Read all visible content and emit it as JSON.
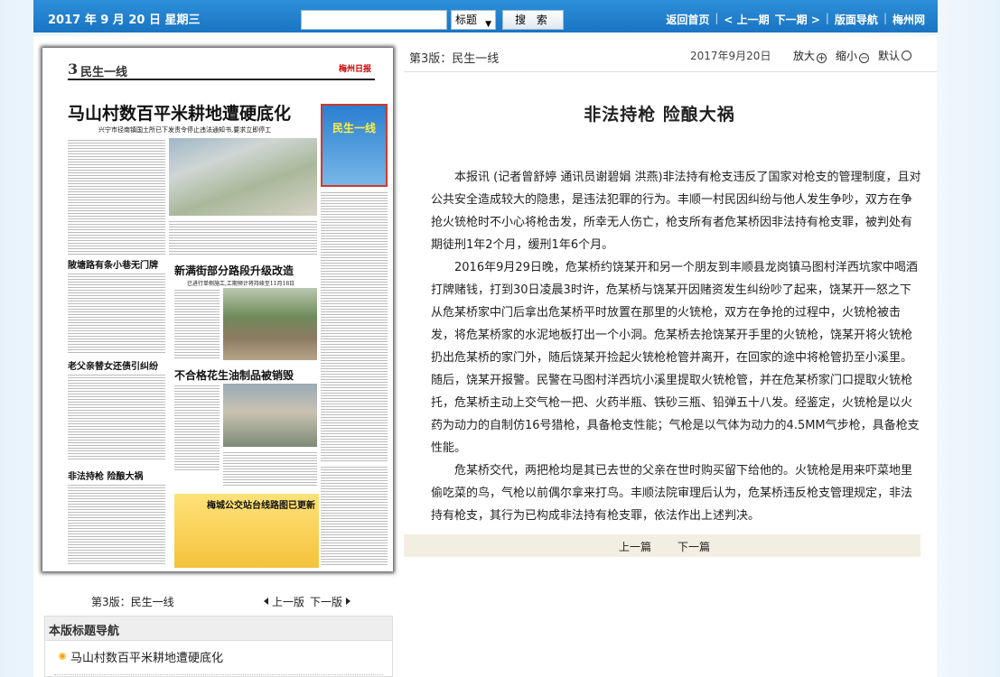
{
  "topbar": {
    "date": "2017 年 9 月 20 日   星期三",
    "search_placeholder": "",
    "select_value": "标题",
    "search_button": "搜 索",
    "nav": [
      "返回首页",
      "< 上一期",
      "下一期 >",
      "版面导航",
      "梅州网"
    ],
    "nav_seps": [
      "|",
      "|",
      "|",
      "|"
    ]
  },
  "paper": {
    "page_num": "3",
    "section": "民生一线",
    "brand": "梅州日报",
    "headlines": {
      "main": "马山村数百平米耕地遭硬底化",
      "main_sub": "兴宁市径南镇国土所已下发责令停止违法通知书,要求立即停工",
      "h2": "陂塘路有条小巷无门牌",
      "h3": "新满街部分路段升级改造",
      "h3_sub": "已进行单侧施工,工期预计将持续至11月18日",
      "h4": "老父亲替女还债引纠纷",
      "h5": "不合格花生油制品被销毁",
      "h6": "非法持枪  险酿大祸",
      "h7": "梅城公交站台线路图已更新",
      "badge": "民生一线"
    }
  },
  "left_pager": {
    "page_label": "第3版：民生一线",
    "prev": "上一版",
    "next": "下一版"
  },
  "nav_box": {
    "header": "本版标题导航",
    "items": [
      "马山村数百平米耕地遭硬底化"
    ]
  },
  "article": {
    "section": "第3版：民生一线",
    "date": "2017年9月20日",
    "zoom_in": "放大",
    "zoom_out": "缩小",
    "zoom_default": "默认",
    "zoom_in_glyph": "+",
    "zoom_out_glyph": "−",
    "title": "非法持枪  险酿大祸",
    "paragraphs": [
      "本报讯 (记者曾舒婷 通讯员谢碧娟 洪燕)非法持有枪支违反了国家对枪支的管理制度，且对公共安全造成较大的隐患，是违法犯罪的行为。丰顺一村民因纠纷与他人发生争吵，双方在争抢火铳枪时不小心将枪击发，所幸无人伤亡，枪支所有者危某桥因非法持有枪支罪，被判处有期徒刑1年2个月，缓刑1年6个月。",
      "2016年9月29日晚，危某桥约饶某开和另一个朋友到丰顺县龙岗镇马图村洋西坑家中喝酒打牌赌钱，打到30日凌晨3时许，危某桥与饶某开因赌资发生纠纷吵了起来，饶某开一怒之下从危某桥家中门后拿出危某桥平时放置在那里的火铳枪，双方在争抢的过程中，火铳枪被击发，将危某桥家的水泥地板打出一个小洞。危某桥去抢饶某开手里的火铳枪，饶某开将火铳枪扔出危某桥的家门外，随后饶某开捡起火铳枪枪管并离开，在回家的途中将枪管扔至小溪里。随后，饶某开报警。民警在马图村洋西坑小溪里提取火铳枪管，并在危某桥家门口提取火铳枪托，危某桥主动上交气枪一把、火药半瓶、铁砂三瓶、铅弹五十八发。经鉴定，火铳枪是以火药为动力的自制仿16号猎枪，具备枪支性能；气枪是以气体为动力的4.5MM气步枪，具备枪支性能。",
      "危某桥交代，两把枪均是其已去世的父亲在世时购买留下给他的。火铳枪是用来吓菜地里偷吃菜的鸟，气枪以前偶尔拿来打鸟。丰顺法院审理后认为，危某桥违反枪支管理规定，非法持有枪支，其行为已构成非法持有枪支罪，依法作出上述判决。"
    ],
    "prev_article": "上一篇",
    "next_article": "下一篇"
  }
}
